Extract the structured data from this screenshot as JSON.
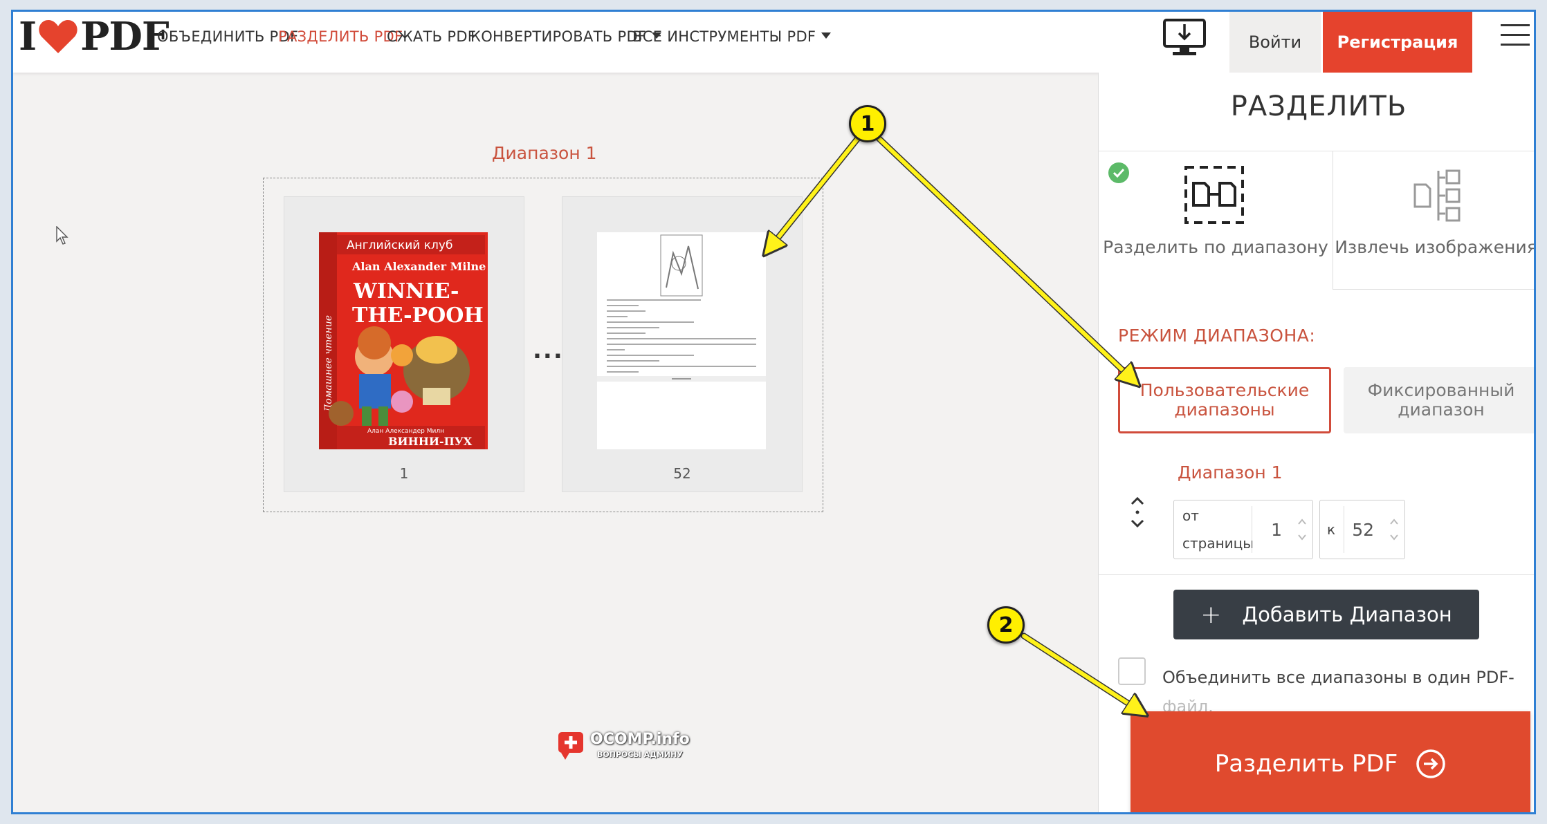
{
  "header": {
    "logo_left": "I",
    "logo_right": "PDF",
    "nav": [
      {
        "label": "ОБЪЕДИНИТЬ PDF"
      },
      {
        "label": "РАЗДЕЛИТЬ PDF"
      },
      {
        "label": "СЖАТЬ PDF"
      },
      {
        "label": "КОНВЕРТИРОВАТЬ PDF"
      },
      {
        "label": "ВСЕ ИНСТРУМЕНТЫ PDF"
      }
    ],
    "login_label": "Войти",
    "signup_label": "Регистрация"
  },
  "preview": {
    "range_title": "Диапазон 1",
    "first_page": {
      "number": "1",
      "cover_series": "Английский клуб",
      "cover_author": "Alan Alexander Milne",
      "cover_title_line1": "WINNIE-",
      "cover_title_line2": "THE-POOH",
      "cover_ru_author": "Алан Александер Милн",
      "cover_ru_title": "ВИННИ-ПУХ",
      "cover_side": "Домашнее чтение"
    },
    "separator": "...",
    "last_page": {
      "number": "52"
    },
    "watermark_line1": "OCOMP.info",
    "watermark_line2": "ВОПРОСЫ АДМИНУ"
  },
  "panel": {
    "title": "РАЗДЕЛИТЬ",
    "modes": [
      {
        "label": "Разделить по диапазону",
        "selected": true
      },
      {
        "label": "Извлечь изображения",
        "selected": false
      }
    ],
    "range_mode_label": "РЕЖИМ ДИАПАЗОНА:",
    "range_modes": [
      {
        "label": "Пользовательские диапазоны",
        "selected": true
      },
      {
        "label": "Фиксированный диапазон",
        "selected": false
      }
    ],
    "range": {
      "label": "Диапазон 1",
      "from_label_line1": "от",
      "from_label_line2": "страницы",
      "from_value": "1",
      "to_label": "к",
      "to_value": "52"
    },
    "add_range_label": "Добавить Диапазон",
    "merge_label": "Объединить все диапазоны в один PDF-",
    "merge_label_cont": "файл.",
    "split_button_label": "Разделить PDF"
  },
  "annotations": [
    {
      "label": "1"
    },
    {
      "label": "2"
    }
  ],
  "colors": {
    "accent": "#e5432d",
    "accent_text": "#c9533e",
    "frame": "#2f7fd3",
    "badge": "#ffef00",
    "dark_button": "#383e45"
  }
}
